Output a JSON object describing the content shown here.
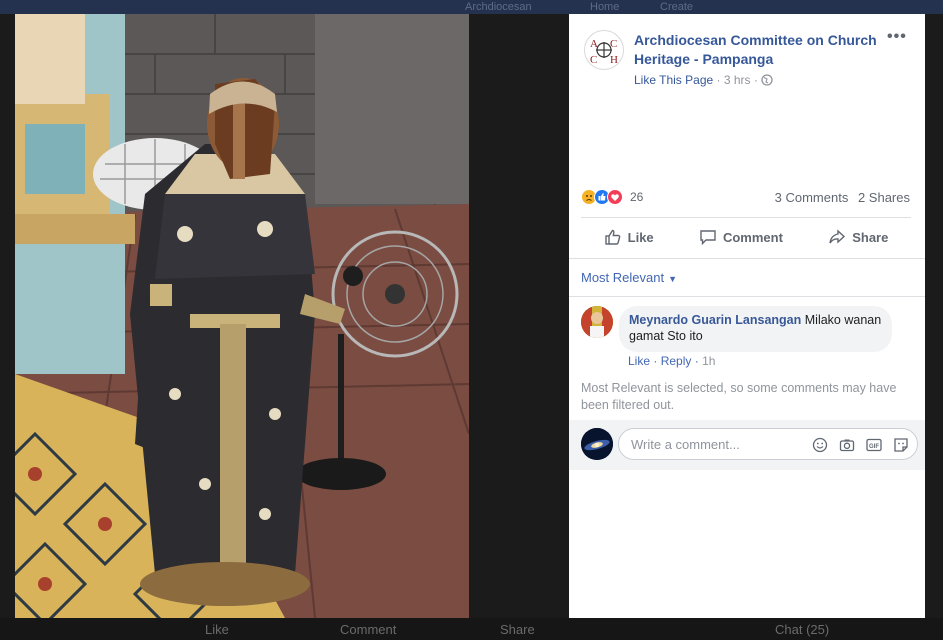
{
  "background": {
    "topbar_left": "Archdiocesan",
    "topbar_mid": "Home",
    "topbar_right": "Create",
    "bottom_like": "Like",
    "bottom_comment": "Comment",
    "bottom_share": "Share",
    "bottom_chat": "Chat (25)"
  },
  "post": {
    "page_name": "Archdiocesan Committee on Church Heritage - Pampanga",
    "like_page": "Like This Page",
    "time": "3 hrs",
    "more": "•••",
    "reaction_count": "26",
    "comments_count": "3 Comments",
    "shares_count": "2 Shares",
    "actions": {
      "like": "Like",
      "comment": "Comment",
      "share": "Share"
    },
    "sort_label": "Most Relevant",
    "comment": {
      "author": "Meynardo Guarin Lansangan",
      "text": "Milako wanan gamat Sto ito",
      "like": "Like",
      "reply": "Reply",
      "time": "1h"
    },
    "filter_note": "Most Relevant is selected, so some comments may have been filtered out.",
    "composer_placeholder": "Write a comment..."
  },
  "colors": {
    "link": "#365899",
    "muted": "#90949c",
    "panel_bg": "#ffffff",
    "dim_bg": "#1b1b1b"
  }
}
